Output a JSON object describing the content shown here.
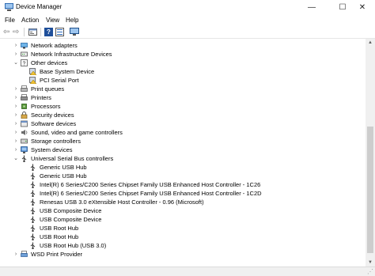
{
  "window": {
    "title": "Device Manager",
    "minimize_glyph": "—",
    "maximize_glyph": "☐",
    "close_glyph": "✕"
  },
  "menu": {
    "file": "File",
    "action": "Action",
    "view": "View",
    "help": "Help"
  },
  "toolbar": {
    "back_glyph": "⇦",
    "forward_glyph": "⇨",
    "help_glyph": "?"
  },
  "tree": {
    "items": [
      {
        "label": "Network adapters",
        "icon": "network-adapter-icon",
        "expanded": false
      },
      {
        "label": "Network Infrastructure Devices",
        "icon": "network-infrastructure-icon",
        "expanded": false
      },
      {
        "label": "Other devices",
        "icon": "other-devices-icon",
        "expanded": true
      },
      {
        "label": "Base System Device",
        "icon": "warning-device-icon",
        "child": true
      },
      {
        "label": "PCI Serial Port",
        "icon": "warning-device-icon",
        "child": true
      },
      {
        "label": "Print queues",
        "icon": "print-queue-icon",
        "expanded": false
      },
      {
        "label": "Printers",
        "icon": "printer-icon",
        "expanded": false
      },
      {
        "label": "Processors",
        "icon": "processor-icon",
        "expanded": false
      },
      {
        "label": "Security devices",
        "icon": "security-icon",
        "expanded": false
      },
      {
        "label": "Software devices",
        "icon": "software-device-icon",
        "expanded": false
      },
      {
        "label": "Sound, video and game controllers",
        "icon": "sound-icon",
        "expanded": false
      },
      {
        "label": "Storage controllers",
        "icon": "storage-icon",
        "expanded": false
      },
      {
        "label": "System devices",
        "icon": "system-device-icon",
        "expanded": false
      },
      {
        "label": "Universal Serial Bus controllers",
        "icon": "usb-controller-icon",
        "expanded": true
      },
      {
        "label": "Generic USB Hub",
        "icon": "usb-icon",
        "child": true
      },
      {
        "label": "Generic USB Hub",
        "icon": "usb-icon",
        "child": true
      },
      {
        "label": "Intel(R) 6 Series/C200 Series Chipset Family USB Enhanced Host Controller - 1C26",
        "icon": "usb-icon",
        "child": true
      },
      {
        "label": "Intel(R) 6 Series/C200 Series Chipset Family USB Enhanced Host Controller - 1C2D",
        "icon": "usb-icon",
        "child": true
      },
      {
        "label": "Renesas USB 3.0 eXtensible Host Controller - 0.96 (Microsoft)",
        "icon": "usb-icon",
        "child": true
      },
      {
        "label": "USB Composite Device",
        "icon": "usb-icon",
        "child": true
      },
      {
        "label": "USB Composite Device",
        "icon": "usb-icon",
        "child": true
      },
      {
        "label": "USB Root Hub",
        "icon": "usb-icon",
        "child": true
      },
      {
        "label": "USB Root Hub",
        "icon": "usb-icon",
        "child": true
      },
      {
        "label": "USB Root Hub (USB 3.0)",
        "icon": "usb-icon",
        "child": true
      },
      {
        "label": "WSD Print Provider",
        "icon": "wsd-print-icon",
        "expanded": false
      }
    ]
  },
  "colors": {
    "folder": "#e8b94a",
    "device_blue": "#3a7bc8",
    "warning": "#f1c232",
    "usb": "#5a5a5a"
  }
}
